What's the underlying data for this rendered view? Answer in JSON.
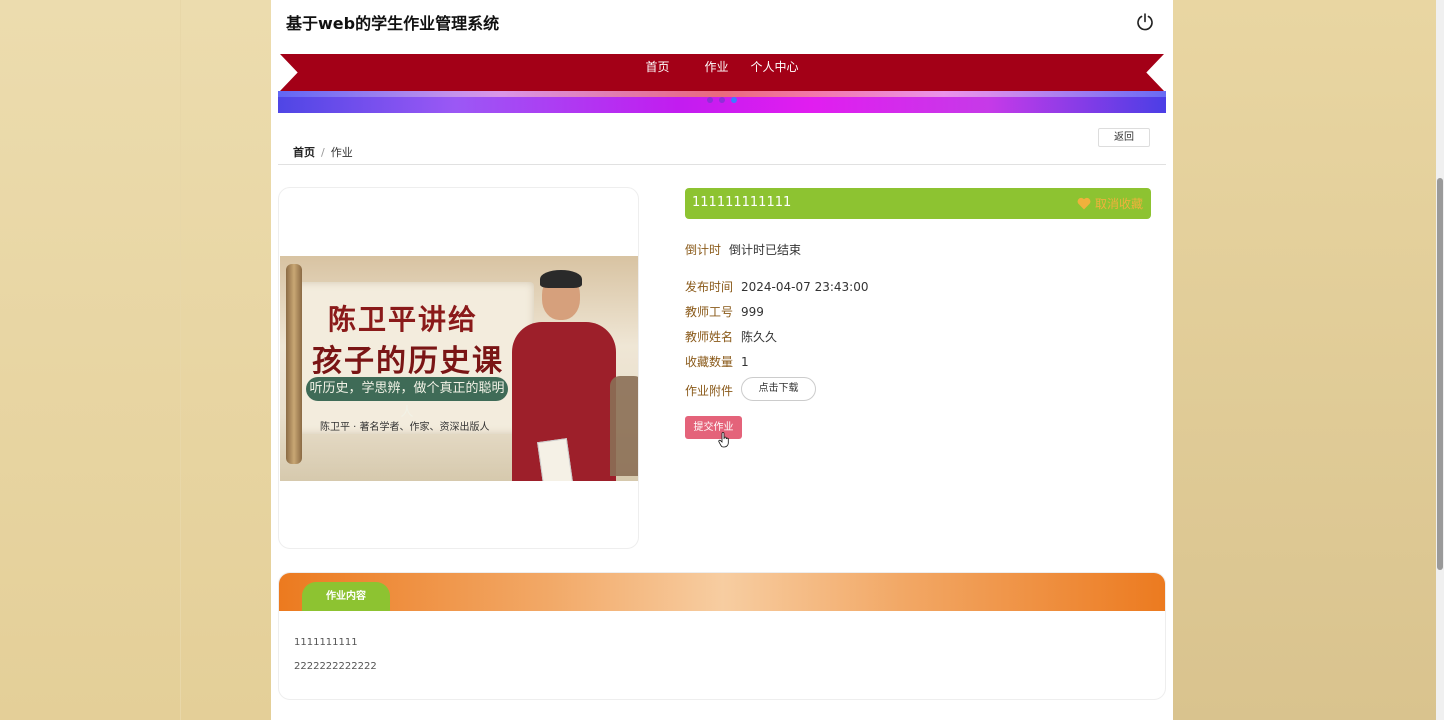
{
  "header": {
    "site_title": "基于web的学生作业管理系统"
  },
  "nav": {
    "items": [
      {
        "label": "首页"
      },
      {
        "label": "作业"
      },
      {
        "label": "个人中心"
      }
    ],
    "active_index": 1
  },
  "breadcrumb": {
    "home": "首页",
    "separator": "/",
    "current": "作业"
  },
  "back_button": {
    "label": "返回"
  },
  "poster": {
    "line1": "陈卫平讲给",
    "line2": "孩子的历史课",
    "tagline": "听历史，学思辨，做个真正的聪明人",
    "byline": "陈卫平 · 著名学者、作家、资深出版人"
  },
  "assignment": {
    "title": "111111111111",
    "favorite_label": "取消收藏",
    "countdown_label": "倒计时",
    "countdown_value": "倒计时已结束",
    "fields": [
      {
        "label": "发布时间",
        "value": "2024-04-07 23:43:00"
      },
      {
        "label": "教师工号",
        "value": "999"
      },
      {
        "label": "教师姓名",
        "value": "陈久久"
      },
      {
        "label": "收藏数量",
        "value": "1"
      }
    ],
    "attachment_label": "作业附件",
    "download_label": "点击下载",
    "submit_label": "提交作业"
  },
  "content": {
    "tab_label": "作业内容",
    "lines": [
      "1111111111",
      "2222222222222"
    ]
  },
  "colors": {
    "nav_red": "#a30017",
    "green": "#8dc331",
    "submit_pink": "#e4637a",
    "orange": "#ec7a1f",
    "heart": "#f0b13c"
  }
}
